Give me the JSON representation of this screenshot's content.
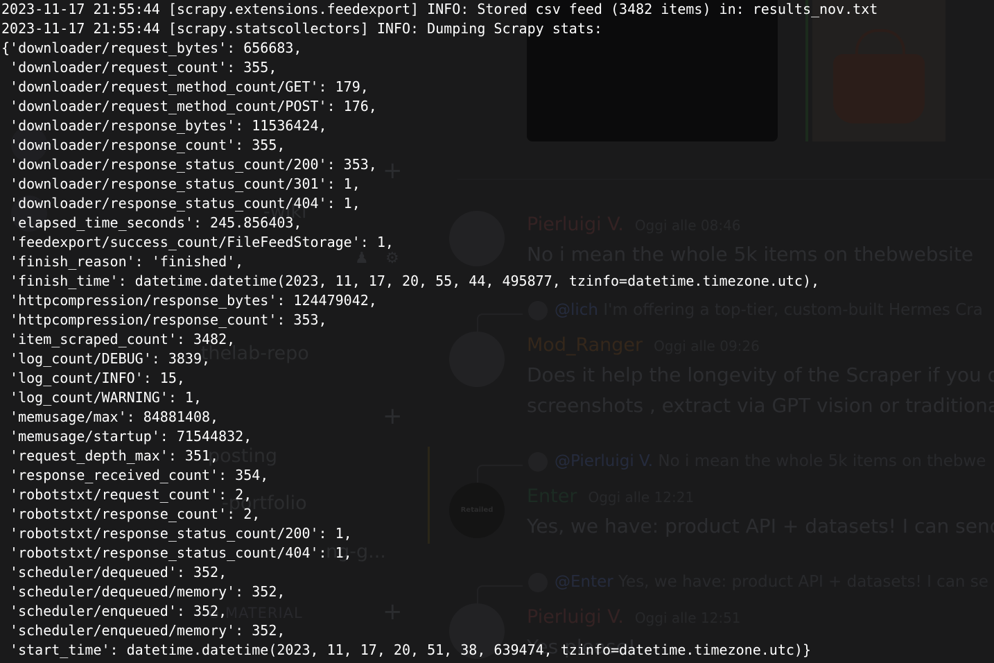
{
  "terminal": {
    "lines": [
      "2023-11-17 21:55:44 [scrapy.extensions.feedexport] INFO: Stored csv feed (3482 items) in: results_nov.txt",
      "2023-11-17 21:55:44 [scrapy.statscollectors] INFO: Dumping Scrapy stats:",
      "{'downloader/request_bytes': 656683,",
      " 'downloader/request_count': 355,",
      " 'downloader/request_method_count/GET': 179,",
      " 'downloader/request_method_count/POST': 176,",
      " 'downloader/response_bytes': 11536424,",
      " 'downloader/response_count': 355,",
      " 'downloader/response_status_count/200': 353,",
      " 'downloader/response_status_count/301': 1,",
      " 'downloader/response_status_count/404': 1,",
      " 'elapsed_time_seconds': 245.856403,",
      " 'feedexport/success_count/FileFeedStorage': 1,",
      " 'finish_reason': 'finished',",
      " 'finish_time': datetime.datetime(2023, 11, 17, 20, 55, 44, 495877, tzinfo=datetime.timezone.utc),",
      " 'httpcompression/response_bytes': 124479042,",
      " 'httpcompression/response_count': 353,",
      " 'item_scraped_count': 3482,",
      " 'log_count/DEBUG': 3839,",
      " 'log_count/INFO': 15,",
      " 'log_count/WARNING': 1,",
      " 'memusage/max': 84881408,",
      " 'memusage/startup': 71544832,",
      " 'request_depth_max': 351,",
      " 'response_received_count': 354,",
      " 'robotstxt/request_count': 2,",
      " 'robotstxt/response_count': 2,",
      " 'robotstxt/response_status_count/200': 1,",
      " 'robotstxt/response_status_count/404': 1,",
      " 'scheduler/dequeued': 352,",
      " 'scheduler/dequeued/memory': 352,",
      " 'scheduler/enqueued': 352,",
      " 'scheduler/enqueued/memory': 352,",
      " 'start_time': datetime.datetime(2023, 11, 17, 20, 51, 38, 639474, tzinfo=datetime.timezone.utc)}"
    ]
  },
  "background": {
    "channels": {
      "wiki": "-wiki",
      "repo": "-thelab-repo",
      "posting": "posting",
      "portfolio": "-portfolio",
      "scraping": "ng-g..."
    },
    "section_label": "G MATERIAL",
    "messages": [
      {
        "author": "Pierluigi V.",
        "author_color": "#4a2a2a",
        "time": "Oggi alle 08:46",
        "lines": [
          "No i mean the whole 5k items on thebwebsite"
        ]
      },
      {
        "reply_mention": "@lich",
        "reply_text": "I'm offering a top-tier, custom-built Hermes Cra",
        "author": "Mod_Ranger",
        "author_color": "#4a321c",
        "time": "Oggi alle 09:26",
        "lines": [
          "Does it help the longevity of the Scraper if you do",
          "screenshots , extract via GPT vision or traditional"
        ]
      },
      {
        "reply_mention": "@Pierluigi V.",
        "reply_text": "No i mean the whole 5k items on thebwe",
        "author": "Enter",
        "author_color": "#1f3a2a",
        "time": "Oggi alle 12:21",
        "avatar_label": "Retailed",
        "lines": [
          "Yes, we have:  product API + datasets! I can send y"
        ]
      },
      {
        "reply_mention": "@Enter",
        "reply_text": "Yes, we have: product API + datasets! I can se",
        "author": "Pierluigi V.",
        "author_color": "#4a2a2a",
        "time": "Oggi alle 12:51",
        "lines": [
          "Yes please!"
        ]
      }
    ]
  }
}
